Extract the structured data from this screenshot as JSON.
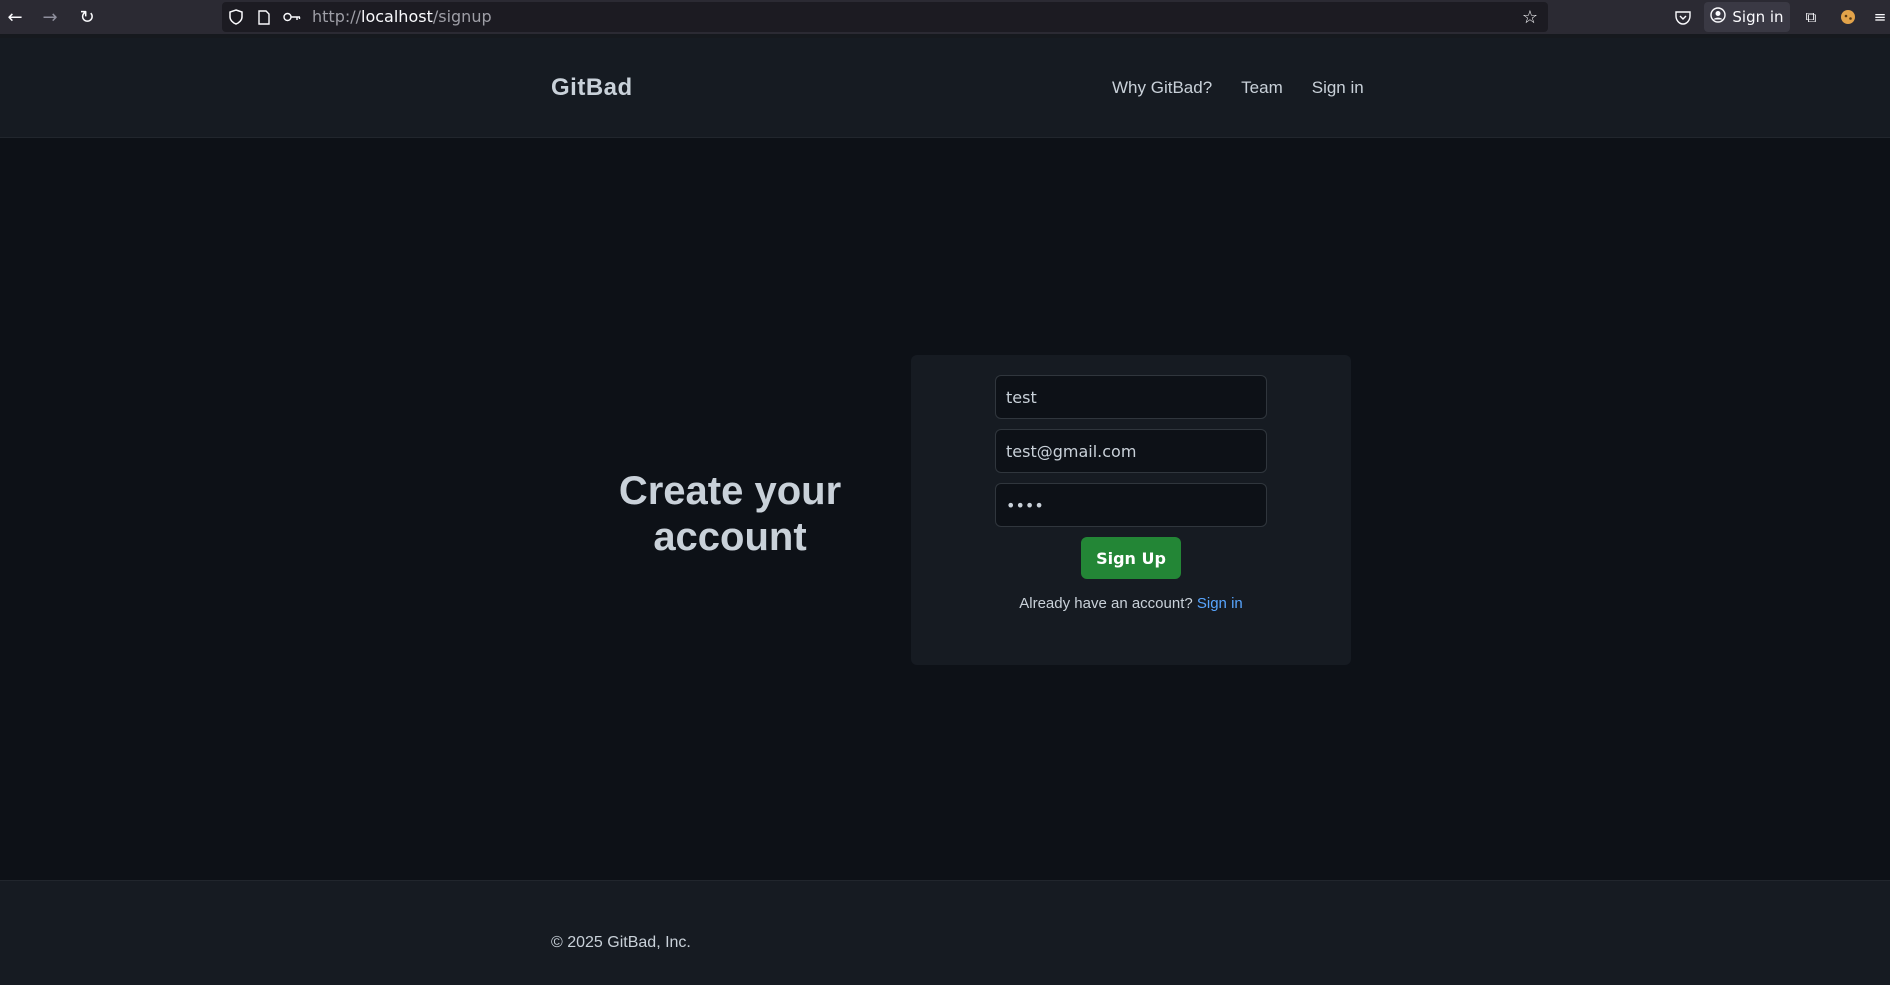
{
  "browser": {
    "back_icon": "←",
    "forward_icon": "→",
    "reload_icon": "↻",
    "url_scheme": "http://",
    "url_host": "localhost",
    "url_path": "/signup",
    "bookmark_icon": "☆",
    "pocket_icon": "♡",
    "account_label": "Sign in",
    "extensions_icon": "⧉",
    "menu_icon": "≡"
  },
  "header": {
    "logo": "GitBad",
    "nav": [
      "Why GitBad?",
      "Team",
      "Sign in"
    ]
  },
  "main": {
    "title": "Create your account"
  },
  "form": {
    "username_value": "test",
    "email_value": "test@gmail.com",
    "password_value": "test",
    "submit_label": "Sign Up",
    "already_text": "Already have an account?",
    "signin_link": "Sign in"
  },
  "footer": {
    "copyright": "© 2025 GitBad, Inc."
  },
  "colors": {
    "page_bg": "#0d1117",
    "panel_bg": "#161b22",
    "text": "#c9d1d9",
    "link": "#58a6ff",
    "primary_button": "#238636"
  }
}
